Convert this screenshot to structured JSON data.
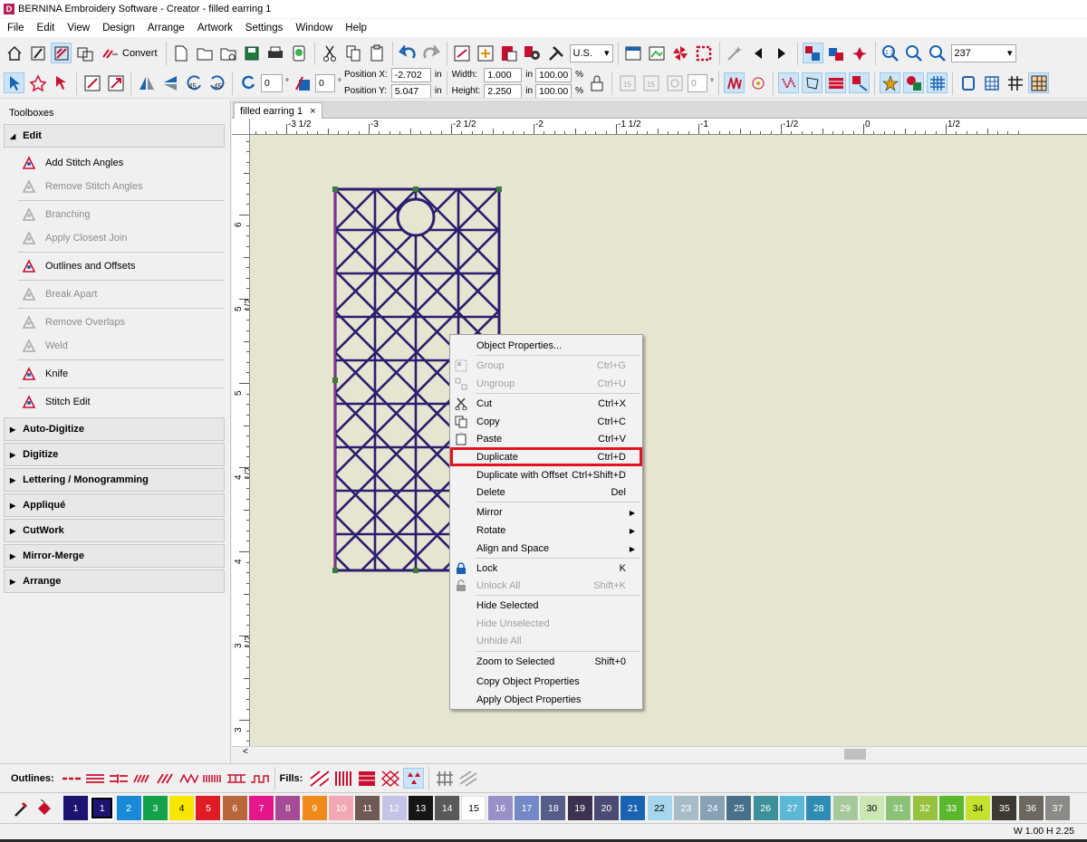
{
  "window": {
    "title": "BERNINA Embroidery Software - Creator - filled earring 1"
  },
  "menu": [
    "File",
    "Edit",
    "View",
    "Design",
    "Arrange",
    "Artwork",
    "Settings",
    "Window",
    "Help"
  ],
  "toolbar1": {
    "convert_label": "Convert",
    "units": "U.S.",
    "zoom": "237"
  },
  "toolbar2": {
    "rotate_value": "0",
    "slant_value": "0",
    "position_x_label": "Position X:",
    "position_x": "-2.702",
    "position_y_label": "Position Y:",
    "position_y": "5.047",
    "width_label": "Width:",
    "width": "1.000",
    "height_label": "Height:",
    "height": "2.250",
    "unit": "in",
    "scale_w": "100.00",
    "scale_h": "100.00",
    "percent": "%",
    "stitch_angle_value": "0"
  },
  "toolboxes": {
    "title": "Toolboxes",
    "edit_header": "Edit",
    "edit_tools": [
      {
        "label": "Add Stitch Angles",
        "enabled": true
      },
      {
        "label": "Remove Stitch Angles",
        "enabled": false
      },
      {
        "label": "Branching",
        "enabled": false
      },
      {
        "label": "Apply Closest Join",
        "enabled": false
      },
      {
        "label": "Outlines and Offsets",
        "enabled": true
      },
      {
        "label": "Break Apart",
        "enabled": false
      },
      {
        "label": "Remove Overlaps",
        "enabled": false
      },
      {
        "label": "Weld",
        "enabled": false
      },
      {
        "label": "Knife",
        "enabled": true
      },
      {
        "label": "Stitch Edit",
        "enabled": true
      }
    ],
    "sections": [
      "Auto-Digitize",
      "Digitize",
      "Lettering / Monogramming",
      "Appliqué",
      "CutWork",
      "Mirror-Merge",
      "Arrange"
    ]
  },
  "document": {
    "tab": "filled earring 1",
    "close": "×"
  },
  "rulers": {
    "h_labels": [
      "-3 1/2",
      "-3",
      "-2 1/2",
      "-2",
      "-1 1/2",
      "-1",
      "-1/2",
      "0",
      "1/2"
    ],
    "v_labels": [
      "6",
      "5 1/2",
      "5",
      "4 1/2",
      "4",
      "3 1/2",
      "3"
    ]
  },
  "context_menu": {
    "items": [
      {
        "label": "Object Properties...",
        "shortcut": "",
        "enabled": true
      },
      {
        "label": "Group",
        "shortcut": "Ctrl+G",
        "enabled": false
      },
      {
        "label": "Ungroup",
        "shortcut": "Ctrl+U",
        "enabled": false
      },
      {
        "label": "Cut",
        "shortcut": "Ctrl+X",
        "enabled": true
      },
      {
        "label": "Copy",
        "shortcut": "Ctrl+C",
        "enabled": true
      },
      {
        "label": "Paste",
        "shortcut": "Ctrl+V",
        "enabled": true
      },
      {
        "label": "Duplicate",
        "shortcut": "Ctrl+D",
        "enabled": true
      },
      {
        "label": "Duplicate with Offset",
        "shortcut": "Ctrl+Shift+D",
        "enabled": true
      },
      {
        "label": "Delete",
        "shortcut": "Del",
        "enabled": true
      },
      {
        "label": "Mirror",
        "shortcut": "",
        "enabled": true
      },
      {
        "label": "Rotate",
        "shortcut": "",
        "enabled": true
      },
      {
        "label": "Align and Space",
        "shortcut": "",
        "enabled": true
      },
      {
        "label": "Lock",
        "shortcut": "K",
        "enabled": true
      },
      {
        "label": "Unlock All",
        "shortcut": "Shift+K",
        "enabled": false
      },
      {
        "label": "Hide Selected",
        "shortcut": "",
        "enabled": true
      },
      {
        "label": "Hide Unselected",
        "shortcut": "",
        "enabled": false
      },
      {
        "label": "Unhide All",
        "shortcut": "",
        "enabled": false
      },
      {
        "label": "Zoom to Selected",
        "shortcut": "Shift+0",
        "enabled": true
      },
      {
        "label": "Copy Object Properties",
        "shortcut": "",
        "enabled": true
      },
      {
        "label": "Apply Object Properties",
        "shortcut": "",
        "enabled": true
      }
    ],
    "highlighted": "Duplicate"
  },
  "bottom": {
    "outlines_label": "Outlines:",
    "fills_label": "Fills:"
  },
  "palette": {
    "current": "1",
    "swatches": [
      {
        "n": "1",
        "c": "#1c1470"
      },
      {
        "n": "2",
        "c": "#1a8ad8"
      },
      {
        "n": "3",
        "c": "#13a24a"
      },
      {
        "n": "4",
        "c": "#f6e600"
      },
      {
        "n": "5",
        "c": "#e01b24"
      },
      {
        "n": "6",
        "c": "#b8673a"
      },
      {
        "n": "7",
        "c": "#e3168a"
      },
      {
        "n": "8",
        "c": "#a54a94"
      },
      {
        "n": "9",
        "c": "#f08a1a"
      },
      {
        "n": "10",
        "c": "#f2a8b4"
      },
      {
        "n": "11",
        "c": "#6e5a52"
      },
      {
        "n": "12",
        "c": "#c5c4e6"
      },
      {
        "n": "13",
        "c": "#151515"
      },
      {
        "n": "14",
        "c": "#58595b"
      },
      {
        "n": "15",
        "c": "#ffffff"
      },
      {
        "n": "16",
        "c": "#9b8fc8"
      },
      {
        "n": "17",
        "c": "#7488c8"
      },
      {
        "n": "18",
        "c": "#545e88"
      },
      {
        "n": "19",
        "c": "#3c3250"
      },
      {
        "n": "20",
        "c": "#4a4a72"
      },
      {
        "n": "21",
        "c": "#1a62b2"
      },
      {
        "n": "22",
        "c": "#a6d6ee"
      },
      {
        "n": "23",
        "c": "#a8bcc8"
      },
      {
        "n": "24",
        "c": "#88a2b4"
      },
      {
        "n": "25",
        "c": "#48708a"
      },
      {
        "n": "26",
        "c": "#3e9098"
      },
      {
        "n": "27",
        "c": "#5cb8d6"
      },
      {
        "n": "28",
        "c": "#2e8cb4"
      },
      {
        "n": "29",
        "c": "#a6c89a"
      },
      {
        "n": "30",
        "c": "#cce8b2"
      },
      {
        "n": "31",
        "c": "#8cc278"
      },
      {
        "n": "32",
        "c": "#98c23e"
      },
      {
        "n": "33",
        "c": "#5ab82c"
      },
      {
        "n": "34",
        "c": "#c4e22e"
      },
      {
        "n": "35",
        "c": "#3c3832"
      },
      {
        "n": "36",
        "c": "#6c6860"
      },
      {
        "n": "37",
        "c": "#8c8a86"
      }
    ]
  },
  "status": {
    "size": "W 1.00  H 2.25"
  },
  "colors": {
    "accent": "#e0151f",
    "canvas": "#e8e4d2",
    "stitch": "#2a1f6e"
  }
}
